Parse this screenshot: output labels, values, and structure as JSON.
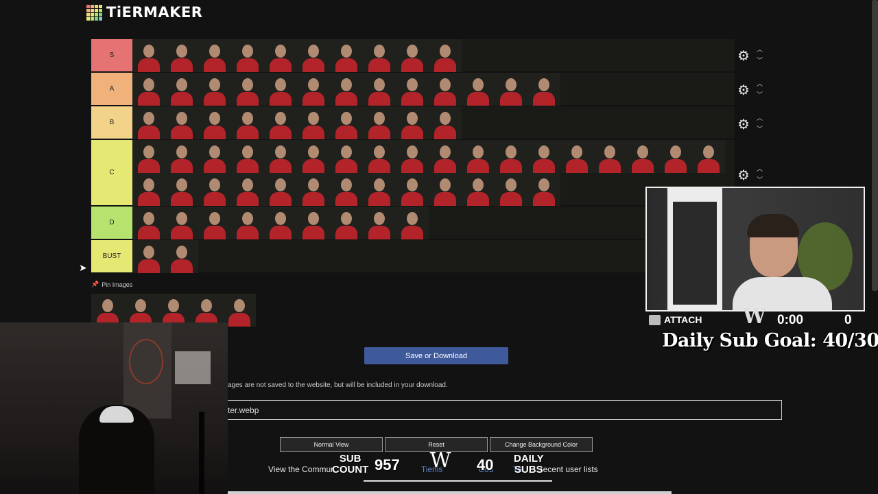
{
  "header": {
    "logo_text": "TiERMAKER"
  },
  "tiers": [
    {
      "label": "S",
      "color": "#e57373",
      "count": 10
    },
    {
      "label": "A",
      "color": "#f0b27a",
      "count": 13
    },
    {
      "label": "B",
      "color": "#f2d389",
      "count": 10
    },
    {
      "label": "C",
      "color": "#e5e873",
      "count": 31
    },
    {
      "label": "D",
      "color": "#b6e26e",
      "count": 9
    },
    {
      "label": "BUST",
      "color": "#e5e873",
      "count": 2
    }
  ],
  "pin_images": {
    "label": "Pin Images",
    "count": 5
  },
  "save_button": "Save or Download",
  "note_text": "ages are not saved to the website, but will be included in your download.",
  "file_field": {
    "value": "ter.webp"
  },
  "buttons": {
    "normal_view": "Normal View",
    "reset": "Reset",
    "change_bg": "Change Background Color"
  },
  "footer": {
    "prefix": "View the Commun",
    "link1": "Tierlis",
    "link2": "Cod",
    "link3": "Tie",
    "suffix": "recent user lists"
  },
  "stream": {
    "attach_label": "ATTACH",
    "timer": "0:00",
    "counter": "0",
    "daily_goal": "Daily Sub Goal: 40/30"
  },
  "sub_overlay": {
    "sub_label_1": "SUB",
    "sub_label_2": "COUNT",
    "sub_count": "957",
    "daily_count": "40",
    "daily_label_1": "DAILY",
    "daily_label_2": "SUBS"
  }
}
